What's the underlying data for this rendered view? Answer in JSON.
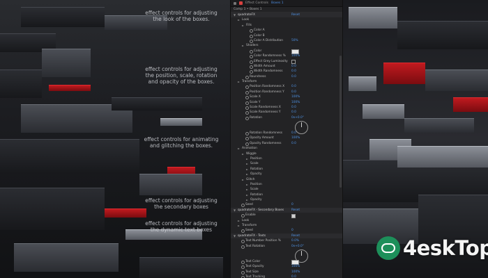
{
  "captions": [
    "effect controls for adjusting the look of the boxes.",
    "effect controls for adjusting the position, scale, rotation and opacity of the boxes.",
    "effect controls for animating and glitching the boxes.",
    "effect controls for adjusting the secondary boxes",
    "effect controls for adjusting the dynamic text boxes"
  ],
  "panel": {
    "tab_title": "Effect Controls",
    "tab_target": "Boxes 1",
    "comp_label": "Comp 1 • Boxes 1",
    "rows": [
      {
        "kind": "fx",
        "indent": 0,
        "label": "quadrateFX",
        "reset": "Reset"
      },
      {
        "kind": "group",
        "indent": 1,
        "label": "Look"
      },
      {
        "kind": "group",
        "indent": 2,
        "label": "Fills"
      },
      {
        "kind": "prop",
        "indent": 3,
        "label": "Color A",
        "sw": true
      },
      {
        "kind": "prop",
        "indent": 3,
        "label": "Color B",
        "sw": true
      },
      {
        "kind": "prop",
        "indent": 3,
        "label": "Color A Distribution",
        "sw": true,
        "value": "50%"
      },
      {
        "kind": "group",
        "indent": 2,
        "label": "Shaders"
      },
      {
        "kind": "prop",
        "indent": 3,
        "label": "Color",
        "sw": true,
        "color": true
      },
      {
        "kind": "prop",
        "indent": 3,
        "label": "Color Randomness %",
        "sw": true,
        "value": "100%"
      },
      {
        "kind": "prop",
        "indent": 3,
        "label": "Effect Grey Luminosity",
        "sw": true,
        "check": false
      },
      {
        "kind": "prop",
        "indent": 3,
        "label": "Width Amount",
        "sw": true,
        "value": "0.0"
      },
      {
        "kind": "prop",
        "indent": 3,
        "label": "Width Randomness",
        "sw": true,
        "value": "0.0"
      },
      {
        "kind": "prop",
        "indent": 2,
        "label": "Roundness",
        "sw": true,
        "value": "0.0"
      },
      {
        "kind": "group",
        "indent": 1,
        "label": "Transform"
      },
      {
        "kind": "prop",
        "indent": 2,
        "label": "Position Randomness X",
        "sw": true,
        "value": "0.0"
      },
      {
        "kind": "prop",
        "indent": 2,
        "label": "Position Randomness Y",
        "sw": true,
        "value": "0.0"
      },
      {
        "kind": "prop",
        "indent": 2,
        "label": "Scale X",
        "sw": true,
        "value": "100%"
      },
      {
        "kind": "prop",
        "indent": 2,
        "label": "Scale Y",
        "sw": true,
        "value": "100%"
      },
      {
        "kind": "prop",
        "indent": 2,
        "label": "Scale Randomness X",
        "sw": true,
        "value": "0.0"
      },
      {
        "kind": "prop",
        "indent": 2,
        "label": "Scale Randomness Y",
        "sw": true,
        "value": "0.0"
      },
      {
        "kind": "prop",
        "indent": 2,
        "label": "Rotation",
        "sw": true,
        "value": "0x+0.0°",
        "dial": true
      },
      {
        "kind": "spacer"
      },
      {
        "kind": "spacer"
      },
      {
        "kind": "prop",
        "indent": 2,
        "label": "Rotation Randomness",
        "sw": true,
        "value": "0.0"
      },
      {
        "kind": "prop",
        "indent": 2,
        "label": "Opacity Amount",
        "sw": true,
        "value": "100%"
      },
      {
        "kind": "prop",
        "indent": 2,
        "label": "Opacity Randomness",
        "sw": true,
        "value": "0.0"
      },
      {
        "kind": "group",
        "indent": 1,
        "label": "Animation"
      },
      {
        "kind": "group",
        "indent": 2,
        "label": "Wiggle"
      },
      {
        "kind": "group",
        "indent": 3,
        "label": "Position"
      },
      {
        "kind": "group",
        "indent": 3,
        "label": "Scale"
      },
      {
        "kind": "group",
        "indent": 3,
        "label": "Rotation"
      },
      {
        "kind": "group",
        "indent": 3,
        "label": "Opacity"
      },
      {
        "kind": "group",
        "indent": 2,
        "label": "Glitch"
      },
      {
        "kind": "group",
        "indent": 3,
        "label": "Position"
      },
      {
        "kind": "group",
        "indent": 3,
        "label": "Scale"
      },
      {
        "kind": "group",
        "indent": 3,
        "label": "Rotation"
      },
      {
        "kind": "group",
        "indent": 3,
        "label": "Opacity"
      },
      {
        "kind": "prop",
        "indent": 1,
        "label": "Seed",
        "sw": true,
        "value": "0"
      },
      {
        "kind": "fx",
        "indent": 0,
        "label": "quadrateFX - Secondary Boxes",
        "reset": "Reset"
      },
      {
        "kind": "prop",
        "indent": 1,
        "label": "Enable",
        "sw": true,
        "check": true
      },
      {
        "kind": "group",
        "indent": 1,
        "label": "Look"
      },
      {
        "kind": "group",
        "indent": 1,
        "label": "Transform"
      },
      {
        "kind": "prop",
        "indent": 1,
        "label": "Seed",
        "sw": true,
        "value": "0"
      },
      {
        "kind": "fx",
        "indent": 0,
        "label": "quadrateFX - Texts",
        "reset": "Reset"
      },
      {
        "kind": "prop",
        "indent": 1,
        "label": "Text Number Position %",
        "sw": true,
        "value": "0.0%"
      },
      {
        "kind": "prop",
        "indent": 1,
        "label": "Text Rotation",
        "sw": true,
        "value": "0x+0.0°",
        "dial": true
      },
      {
        "kind": "spacer"
      },
      {
        "kind": "spacer"
      },
      {
        "kind": "prop",
        "indent": 1,
        "label": "Text Color",
        "sw": true,
        "color": true
      },
      {
        "kind": "prop",
        "indent": 1,
        "label": "Text Opacity",
        "sw": true,
        "value": "100%"
      },
      {
        "kind": "prop",
        "indent": 1,
        "label": "Text Size",
        "sw": true,
        "value": "100%"
      },
      {
        "kind": "prop",
        "indent": 1,
        "label": "Text Tracking",
        "sw": true,
        "value": "0.0"
      },
      {
        "kind": "prop",
        "indent": 1,
        "label": "Text Type",
        "sw": true,
        "dropdown": "Position X"
      }
    ]
  },
  "watermark": {
    "brand": "4eskTop"
  },
  "colors": {
    "accent": "#4f93e6",
    "scene_red": "#c01a1f",
    "watermark_green": "#1d8f5a"
  }
}
